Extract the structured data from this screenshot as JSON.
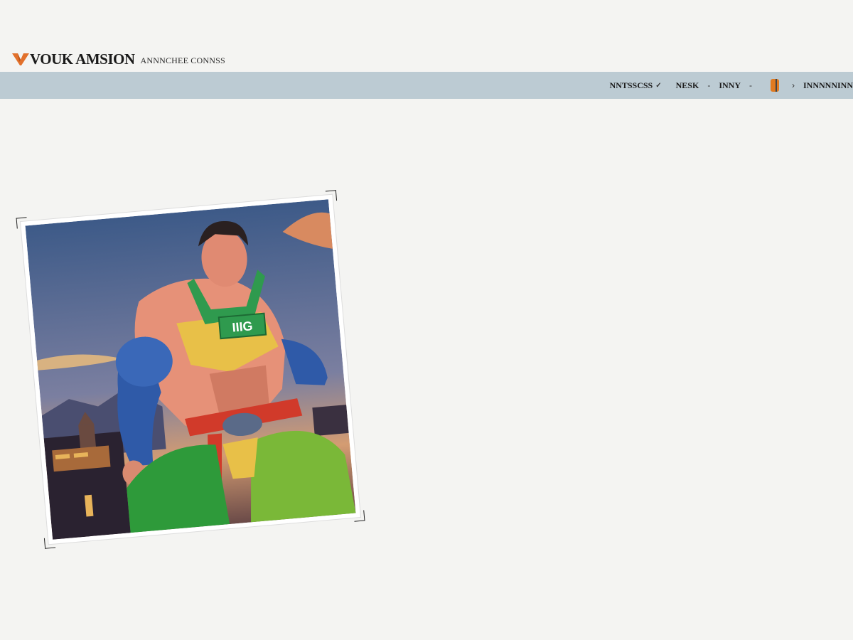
{
  "header": {
    "logo_text": "VOUK AMSION",
    "tagline": "ANNNCHEE CONNSS",
    "logo_icon": "v-chevron-icon",
    "brand_color": "#e2712c"
  },
  "nav": {
    "items": [
      {
        "label": "NNTSSCSS",
        "has_dropdown": true
      },
      {
        "label": "NESK",
        "has_dropdown": false
      },
      {
        "label": "INNY",
        "has_dropdown": false
      },
      {
        "label": "INNNNNINN",
        "has_dropdown": false
      }
    ],
    "separator": "-",
    "chevron": "✓",
    "arrow": "›"
  },
  "artwork": {
    "chest_label": "IIIG"
  },
  "colors": {
    "navbar": "#bccbd3",
    "background": "#f4f4f2",
    "accent": "#e07a20"
  }
}
